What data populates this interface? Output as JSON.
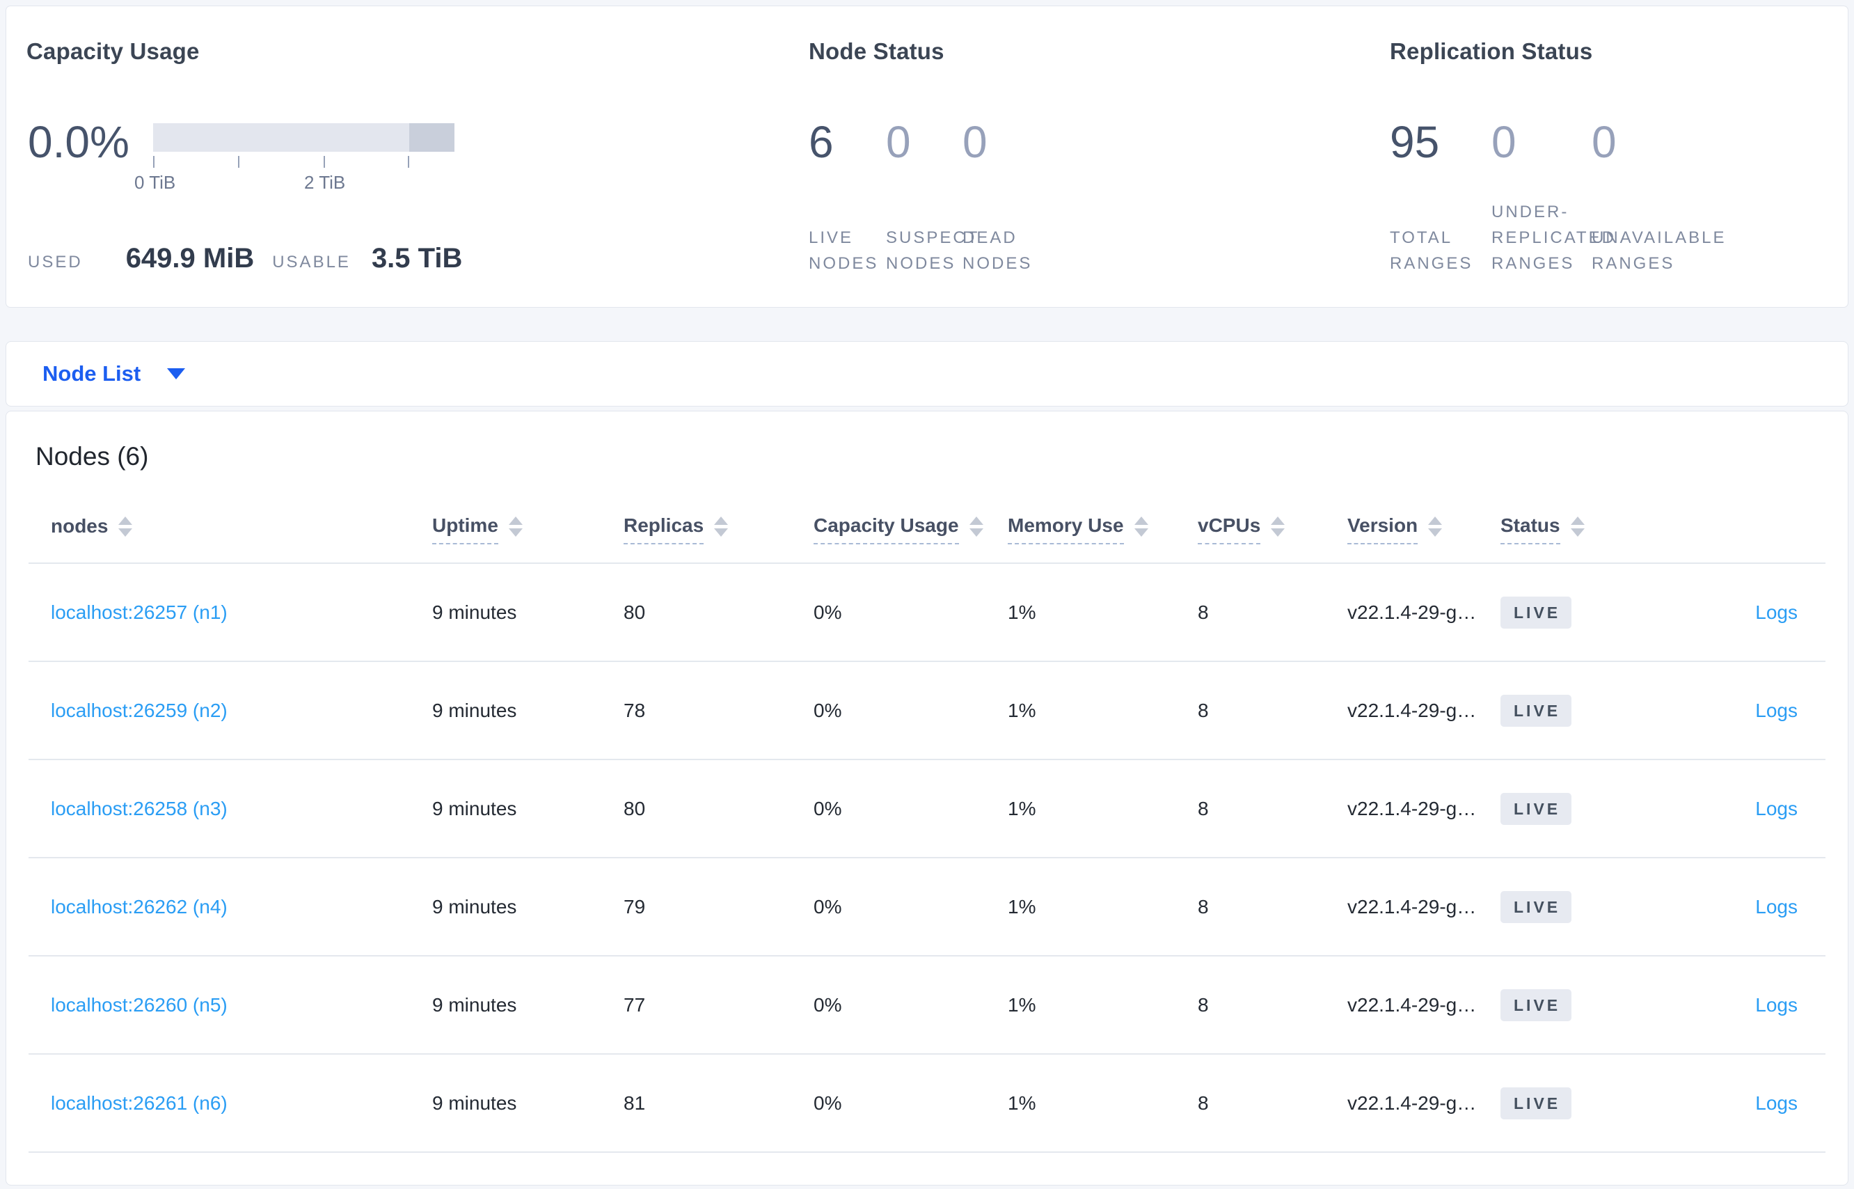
{
  "overview": {
    "capacity": {
      "title": "Capacity Usage",
      "percent": "0.0%",
      "axis_ticks": [
        {
          "label": "0 TiB"
        },
        {
          "label": ""
        },
        {
          "label": "2 TiB"
        },
        {
          "label": ""
        }
      ],
      "used_label": "USED",
      "used_value": "649.9 MiB",
      "usable_label": "USABLE",
      "usable_value": "3.5 TiB"
    },
    "node_status": {
      "title": "Node Status",
      "stats": [
        {
          "value": "6",
          "label": "LIVE\nNODES",
          "emphasis": true
        },
        {
          "value": "0",
          "label": "SUSPECT\nNODES",
          "emphasis": false
        },
        {
          "value": "0",
          "label": "DEAD\nNODES",
          "emphasis": false
        }
      ]
    },
    "replication_status": {
      "title": "Replication Status",
      "stats": [
        {
          "value": "95",
          "label": "TOTAL\nRANGES",
          "emphasis": true
        },
        {
          "value": "0",
          "label": "UNDER-\nREPLICATED\nRANGES",
          "emphasis": false
        },
        {
          "value": "0",
          "label": "UNAVAILABLE\nRANGES",
          "emphasis": false
        }
      ]
    }
  },
  "node_list": {
    "selector_label": "Node List"
  },
  "table": {
    "title": "Nodes (6)",
    "columns": [
      {
        "label": "nodes",
        "underlined": false
      },
      {
        "label": "Uptime",
        "underlined": true
      },
      {
        "label": "Replicas",
        "underlined": true
      },
      {
        "label": "Capacity Usage",
        "underlined": true
      },
      {
        "label": "Memory Use",
        "underlined": true
      },
      {
        "label": "vCPUs",
        "underlined": true
      },
      {
        "label": "Version",
        "underlined": true
      },
      {
        "label": "Status",
        "underlined": true
      }
    ],
    "rows": [
      {
        "node": "localhost:26257 (n1)",
        "uptime": "9 minutes",
        "replicas": "80",
        "capacity": "0%",
        "memory": "1%",
        "vcpus": "8",
        "version": "v22.1.4-29-g…",
        "status": "LIVE",
        "logs": "Logs"
      },
      {
        "node": "localhost:26259 (n2)",
        "uptime": "9 minutes",
        "replicas": "78",
        "capacity": "0%",
        "memory": "1%",
        "vcpus": "8",
        "version": "v22.1.4-29-g…",
        "status": "LIVE",
        "logs": "Logs"
      },
      {
        "node": "localhost:26258 (n3)",
        "uptime": "9 minutes",
        "replicas": "80",
        "capacity": "0%",
        "memory": "1%",
        "vcpus": "8",
        "version": "v22.1.4-29-g…",
        "status": "LIVE",
        "logs": "Logs"
      },
      {
        "node": "localhost:26262 (n4)",
        "uptime": "9 minutes",
        "replicas": "79",
        "capacity": "0%",
        "memory": "1%",
        "vcpus": "8",
        "version": "v22.1.4-29-g…",
        "status": "LIVE",
        "logs": "Logs"
      },
      {
        "node": "localhost:26260 (n5)",
        "uptime": "9 minutes",
        "replicas": "77",
        "capacity": "0%",
        "memory": "1%",
        "vcpus": "8",
        "version": "v22.1.4-29-g…",
        "status": "LIVE",
        "logs": "Logs"
      },
      {
        "node": "localhost:26261 (n6)",
        "uptime": "9 minutes",
        "replicas": "81",
        "capacity": "0%",
        "memory": "1%",
        "vcpus": "8",
        "version": "v22.1.4-29-g…",
        "status": "LIVE",
        "logs": "Logs"
      }
    ]
  },
  "colors": {
    "accent_blue": "#1c5ef0",
    "link_blue": "#2a9df4",
    "bar_light": "#e3e6ee",
    "bar_dark": "#c9cfdb",
    "badge_bg": "#e7eaf1"
  }
}
